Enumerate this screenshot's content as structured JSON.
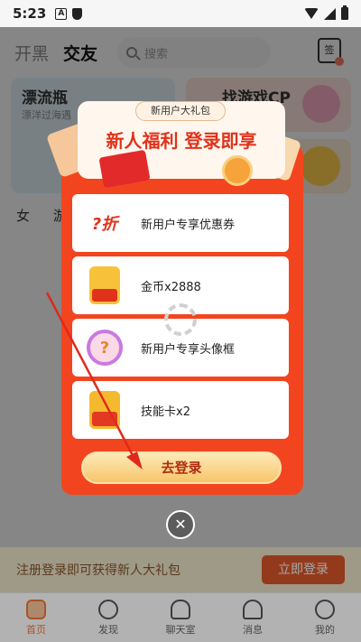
{
  "status_bar": {
    "time": "5:23",
    "icon_a": "A"
  },
  "header": {
    "tabs": [
      {
        "label": "开黑",
        "active": false
      },
      {
        "label": "交友",
        "active": true
      }
    ],
    "search_placeholder": "搜索",
    "checkin_label": "签"
  },
  "cards": {
    "bottle": {
      "title": "漂流瓶",
      "subtitle": "漂洋过海遇"
    },
    "game_cp": {
      "title": "找游戏CP"
    }
  },
  "filters": [
    "女",
    "游"
  ],
  "gift_dialog": {
    "tab_label": "新用户大礼包",
    "headline": "新人福利 登录即享",
    "items": [
      {
        "icon": "discount-coupon-icon",
        "icon_text": "?折",
        "label": "新用户专享优惠券"
      },
      {
        "icon": "gold-coin-packet-icon",
        "label": "金币x2888"
      },
      {
        "icon": "avatar-frame-icon",
        "icon_text": "?",
        "label": "新用户专享头像框"
      },
      {
        "icon": "skill-card-icon",
        "label": "技能卡x2"
      }
    ],
    "login_button": "去登录",
    "close_symbol": "✕"
  },
  "banner": {
    "text": "注册登录即可获得新人大礼包",
    "button": "立即登录"
  },
  "bottom_nav": [
    {
      "label": "首页",
      "icon": "gamepad-icon",
      "active": true
    },
    {
      "label": "发现",
      "icon": "planet-icon",
      "active": false
    },
    {
      "label": "聊天室",
      "icon": "chat-room-icon",
      "active": false
    },
    {
      "label": "消息",
      "icon": "bell-icon",
      "active": false
    },
    {
      "label": "我的",
      "icon": "profile-icon",
      "active": false
    }
  ],
  "colors": {
    "accent": "#f2451f",
    "login_gold": "#f6c56a",
    "nav_active": "#f2793a",
    "banner_button": "#e45a2c",
    "annotation_arrow": "#e0291c"
  }
}
